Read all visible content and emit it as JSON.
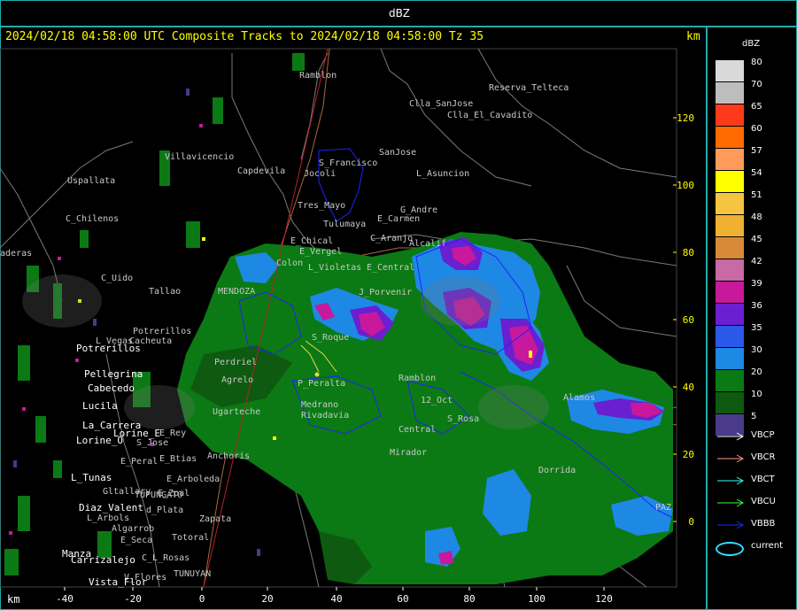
{
  "window": {
    "title": "dBZ"
  },
  "header": {
    "subtitle": "2024/02/18 04:58:00 UTC Composite Tracks to 2024/02/18 04:58:00 Tz 35",
    "km_top": "km",
    "km_bottom": "km"
  },
  "axes": {
    "x_ticks": [
      "-40",
      "-20",
      "0",
      "20",
      "40",
      "60",
      "80",
      "100",
      "120"
    ],
    "y_ticks": [
      "120",
      "100",
      "80",
      "60",
      "40",
      "20",
      "0"
    ]
  },
  "legend": {
    "title": "dBZ",
    "levels": [
      {
        "value": "80",
        "color": "#d9d9d9"
      },
      {
        "value": "70",
        "color": "#bdbdbd"
      },
      {
        "value": "65",
        "color": "#ff3a1a"
      },
      {
        "value": "60",
        "color": "#ff6a00"
      },
      {
        "value": "57",
        "color": "#ff9a5a"
      },
      {
        "value": "54",
        "color": "#ffff00"
      },
      {
        "value": "51",
        "color": "#f5c542"
      },
      {
        "value": "48",
        "color": "#f0b030"
      },
      {
        "value": "45",
        "color": "#d88a3a"
      },
      {
        "value": "42",
        "color": "#c76aa6"
      },
      {
        "value": "39",
        "color": "#c8189c"
      },
      {
        "value": "36",
        "color": "#6a1fd1"
      },
      {
        "value": "35",
        "color": "#2a58e8"
      },
      {
        "value": "30",
        "color": "#1e88e5"
      },
      {
        "value": "20",
        "color": "#0a7a14"
      },
      {
        "value": "10",
        "color": "#0e5a10"
      },
      {
        "value": "5",
        "color": "#4a3a8a"
      }
    ],
    "tracks": [
      {
        "label": "VBCP",
        "color": "#ffffff"
      },
      {
        "label": "VBCR",
        "color": "#ff9a8a"
      },
      {
        "label": "VBCT",
        "color": "#33ffff"
      },
      {
        "label": "VBCU",
        "color": "#33ff33"
      },
      {
        "label": "VBBB",
        "color": "#2222ff"
      },
      {
        "label": "current",
        "color": "#33ddff"
      }
    ]
  },
  "places_gray": [
    {
      "id": "ramblon",
      "name": "Ramblon"
    },
    {
      "id": "reserva",
      "name": "Reserva_Telteca"
    },
    {
      "id": "clla-sanjose",
      "name": "Clla_SanJose"
    },
    {
      "id": "clla-cavadito",
      "name": "Clla_El_Cavadito"
    },
    {
      "id": "sanjose",
      "name": "SanJose"
    },
    {
      "id": "villavicencio",
      "name": "Villavicencio"
    },
    {
      "id": "capdevila",
      "name": "Capdevila"
    },
    {
      "id": "s-francisco",
      "name": "S_Francisco"
    },
    {
      "id": "jocoli",
      "name": "Jocoli"
    },
    {
      "id": "l-asuncion",
      "name": "L_Asuncion"
    },
    {
      "id": "uspallata",
      "name": "Uspallata"
    },
    {
      "id": "tres-mayo",
      "name": "Tres_Mayo"
    },
    {
      "id": "g-andre",
      "name": "G_Andre"
    },
    {
      "id": "c-chilenos",
      "name": "C_Chilenos"
    },
    {
      "id": "e-carmen",
      "name": "E_Carmen"
    },
    {
      "id": "tulumaya",
      "name": "Tulumaya"
    },
    {
      "id": "e-chical",
      "name": "E_Chical"
    },
    {
      "id": "c-aranjo",
      "name": "C_Aranjo"
    },
    {
      "id": "alcalif",
      "name": "Alcalif"
    },
    {
      "id": "e-vergel",
      "name": "E_Vergel"
    },
    {
      "id": "maderas",
      "name": "aderas"
    },
    {
      "id": "colon",
      "name": "Colon"
    },
    {
      "id": "l-violetas",
      "name": "L_Violetas"
    },
    {
      "id": "e-central",
      "name": "E_Central"
    },
    {
      "id": "c-uido",
      "name": "C_Uido"
    },
    {
      "id": "tallao",
      "name": "Tallao"
    },
    {
      "id": "mendoza",
      "name": "MENDOZA"
    },
    {
      "id": "porvenir",
      "name": "J_Porvenir"
    },
    {
      "id": "potrerillos-g",
      "name": "Potrerillos"
    },
    {
      "id": "cacheuta",
      "name": "Cacheuta"
    },
    {
      "id": "l-vegas",
      "name": "L_Vegas"
    },
    {
      "id": "perdriel",
      "name": "Perdriel"
    },
    {
      "id": "agrelo",
      "name": "Agrelo"
    },
    {
      "id": "s-roque",
      "name": "S_Roque"
    },
    {
      "id": "p-peralta",
      "name": "P_Peralta"
    },
    {
      "id": "medrano",
      "name": "Medrano"
    },
    {
      "id": "rivadavia",
      "name": "Rivadavia"
    },
    {
      "id": "12-oct",
      "name": "12_Oct"
    },
    {
      "id": "s-rosa",
      "name": "S_Rosa"
    },
    {
      "id": "ugarteche",
      "name": "Ugarteche"
    },
    {
      "id": "ramblon-2",
      "name": "Ramblon"
    },
    {
      "id": "central",
      "name": "Central"
    },
    {
      "id": "anchoris",
      "name": "Anchoris"
    },
    {
      "id": "zapata",
      "name": "Zapata"
    },
    {
      "id": "mirador",
      "name": "Mirador"
    },
    {
      "id": "dorrida",
      "name": "Dorrida"
    },
    {
      "id": "e-peral",
      "name": "E_Peral"
    },
    {
      "id": "e-arboleda",
      "name": "E_Arboleda"
    },
    {
      "id": "tupungato",
      "name": "TUPUNGATO"
    },
    {
      "id": "e-zpal",
      "name": "E_Zpal"
    },
    {
      "id": "gltallary",
      "name": "Gltallary"
    },
    {
      "id": "l-arbols",
      "name": "L_Arbols"
    },
    {
      "id": "la-plata",
      "name": "d_Plata"
    },
    {
      "id": "algarrob",
      "name": "Algarrob"
    },
    {
      "id": "e-seca",
      "name": "E_Seca"
    },
    {
      "id": "totoral",
      "name": "Totoral"
    },
    {
      "id": "c-rosas",
      "name": "C_L_Rosas"
    },
    {
      "id": "tunuyan",
      "name": "TUNUYAN"
    },
    {
      "id": "v-flores",
      "name": "V_Flores"
    },
    {
      "id": "e-rey",
      "name": "E_Rey"
    },
    {
      "id": "s-jose",
      "name": "S_Jose"
    },
    {
      "id": "e-btias",
      "name": "E_Btias"
    },
    {
      "id": "alamos",
      "name": "Alamos"
    },
    {
      "id": "paz",
      "name": "PAZ"
    }
  ],
  "places_white": [
    {
      "id": "potrerillos",
      "name": "Potrerillos"
    },
    {
      "id": "pellegrina",
      "name": "Pellegrina"
    },
    {
      "id": "cabecedo",
      "name": "Cabecedo"
    },
    {
      "id": "lucila",
      "name": "Lucila"
    },
    {
      "id": "la-carrera",
      "name": "La_Carrera"
    },
    {
      "id": "lorine-o",
      "name": "Lorine_O"
    },
    {
      "id": "lorine-e",
      "name": "Lorine_E"
    },
    {
      "id": "l-tunas",
      "name": "L_Tunas"
    },
    {
      "id": "diaz-valent",
      "name": "Diaz_Valent"
    },
    {
      "id": "carrizalejo",
      "name": "Carrizalejo"
    },
    {
      "id": "vista-flor",
      "name": "Vista_Flor"
    },
    {
      "id": "manzano",
      "name": "Manza"
    }
  ]
}
